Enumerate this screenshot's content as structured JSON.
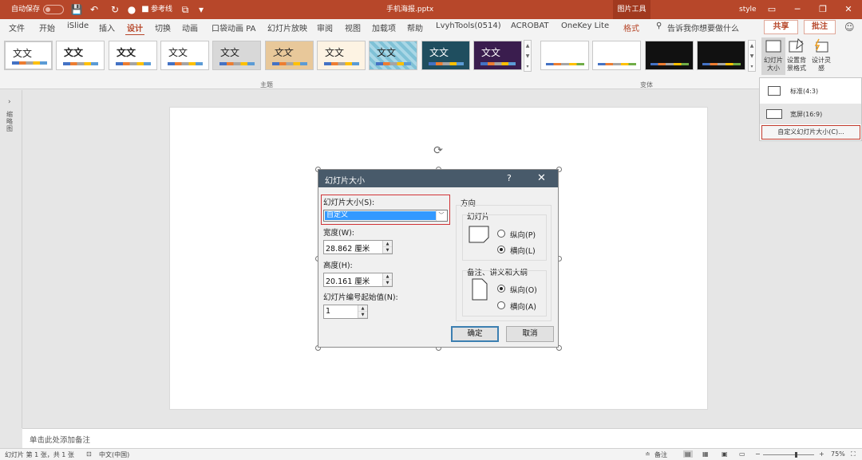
{
  "titlebar": {
    "autosave": "自动保存",
    "autosave_state": "关",
    "guides_label": "参考线",
    "filename": "手机海报.pptx",
    "picture_tools": "图片工具",
    "user": "style",
    "colors": {
      "accent": "#b7472a",
      "dialog_title": "#485a6a",
      "highlight_red": "#d13438"
    }
  },
  "tabs": [
    {
      "label": "文件"
    },
    {
      "label": "开始"
    },
    {
      "label": "iSlide"
    },
    {
      "label": "插入"
    },
    {
      "label": "设计"
    },
    {
      "label": "切换"
    },
    {
      "label": "动画"
    },
    {
      "label": "口袋动画 PA"
    },
    {
      "label": "幻灯片放映"
    },
    {
      "label": "审阅"
    },
    {
      "label": "视图"
    },
    {
      "label": "加载项"
    },
    {
      "label": "帮助"
    },
    {
      "label": "LvyhTools(0514)"
    },
    {
      "label": "ACROBAT"
    },
    {
      "label": "OneKey Lite"
    },
    {
      "label": "格式"
    }
  ],
  "tellme": "告诉我你想要做什么",
  "share_label": "共享",
  "comment_label": "批注",
  "ribbon": {
    "theme_label": "主题",
    "variant_label": "变体",
    "theme_text": "文文",
    "slide_size": "幻灯片大小",
    "format_bg": "设置背景格式",
    "design_ideas": "设计灵感"
  },
  "size_menu": {
    "standard": "标准(4:3)",
    "widescreen": "宽屏(16:9)",
    "custom": "自定义幻灯片大小(C)..."
  },
  "leftpane": {
    "label": "缩略图"
  },
  "dialog": {
    "title": "幻灯片大小",
    "help": "?",
    "close": "✕",
    "size_label": "幻灯片大小(S):",
    "size_value": "自定义",
    "width_label": "宽度(W):",
    "width_value": "28.862 厘米",
    "height_label": "高度(H):",
    "height_value": "20.161 厘米",
    "start_label": "幻灯片编号起始值(N):",
    "start_value": "1",
    "orientation": "方向",
    "slides_group": "幻灯片",
    "notes_group": "备注、讲义和大纲",
    "portrait_p": "纵向(P)",
    "landscape_l": "横向(L)",
    "portrait_o": "纵向(O)",
    "landscape_a": "横向(A)",
    "ok": "确定",
    "cancel": "取消"
  },
  "notes_placeholder": "单击此处添加备注",
  "status": {
    "slide_info": "幻灯片 第 1 张，共 1 张",
    "language": "中文(中国)",
    "notes": "备注",
    "zoom": "75%"
  }
}
